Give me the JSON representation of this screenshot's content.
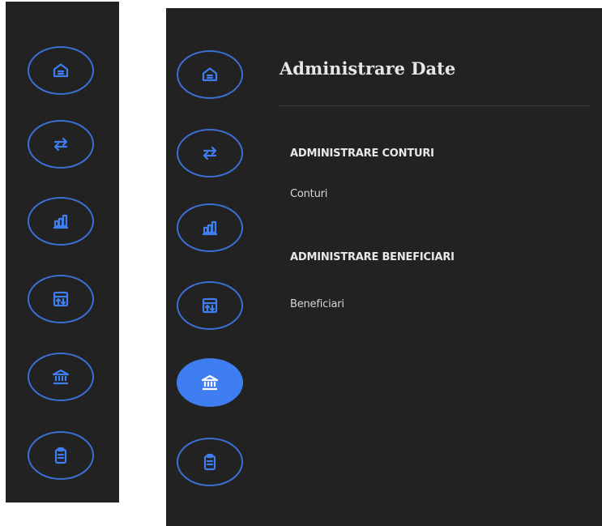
{
  "colors": {
    "panel_background": "#222222",
    "page_background": "#ffffff",
    "accent_blue": "#3e7ef0",
    "icon_outline_blue": "#3b6fd4",
    "text_light": "#e6e6e6"
  },
  "nav_icons": [
    {
      "name": "home-icon",
      "active_in_expanded": false
    },
    {
      "name": "transfer-icon",
      "active_in_expanded": false
    },
    {
      "name": "chart-icon",
      "active_in_expanded": false
    },
    {
      "name": "exchange-rate-icon",
      "active_in_expanded": false
    },
    {
      "name": "bank-icon",
      "active_in_expanded": true
    },
    {
      "name": "clipboard-icon",
      "active_in_expanded": false
    }
  ],
  "menu": {
    "title": "Administrare Date",
    "sections": [
      {
        "heading": "ADMINISTRARE CONTURI",
        "items": [
          "Conturi"
        ]
      },
      {
        "heading": "ADMINISTRARE BENEFICIARI",
        "items": [
          "Beneficiari"
        ]
      }
    ]
  }
}
